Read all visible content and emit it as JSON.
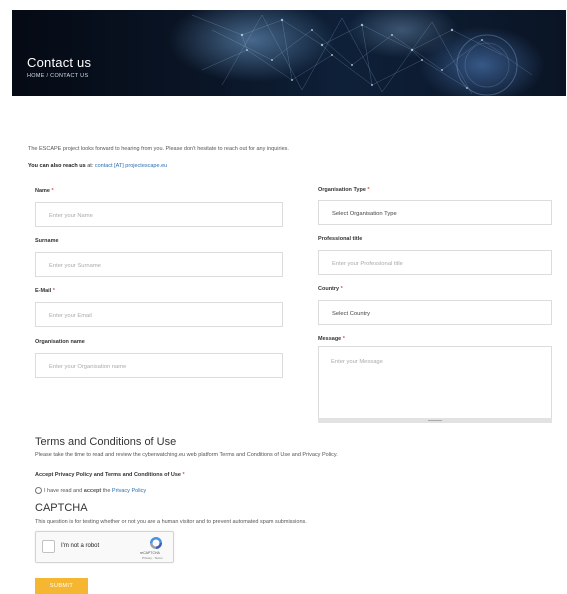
{
  "banner": {
    "title": "Contact us",
    "breadcrumb": "HOME / CONTACT US"
  },
  "intro": {
    "text": "The ESCAPE project looks forward to hearing from you. Please don't hesitate to reach out for any inquiries.",
    "reach_label": "You can also reach us",
    "reach_at": " at: ",
    "reach_email": "contact [AT] projectescape.eu"
  },
  "form": {
    "required_mark": "*",
    "name": {
      "label": "Name",
      "placeholder": "Enter your Name"
    },
    "surname": {
      "label": "Surname",
      "placeholder": "Enter your Surname"
    },
    "email": {
      "label": "E-Mail",
      "placeholder": "Enter your Email"
    },
    "organisation_name": {
      "label": "Organisation name",
      "placeholder": "Enter your Organisation name"
    },
    "organisation_type": {
      "label": "Organisation Type",
      "value": "Select Organisation Type"
    },
    "professional_title": {
      "label": "Professional title",
      "placeholder": "Enter your Professional title"
    },
    "country": {
      "label": "Country",
      "value": "Select Country"
    },
    "message": {
      "label": "Message",
      "placeholder": "Enter your Message"
    }
  },
  "terms": {
    "heading": "Terms and Conditions of Use",
    "text": "Please take the time to read and review the cyberwatching.eu web platform Terms and Conditions of Use and Privacy Policy.",
    "accept_label": "Accept Privacy Policy and Terms and Conditions of Use",
    "checkbox_prefix": "I have read and ",
    "checkbox_bold": "accept",
    "checkbox_the": " the ",
    "checkbox_link": "Privacy Policy"
  },
  "captcha": {
    "heading": "CAPTCHA",
    "text": "This question is for testing whether or not you are a human visitor and to prevent automated spam submissions.",
    "robot_label": "I'm not a robot",
    "brand": "reCAPTCHA",
    "privacy_terms": "Privacy - Terms"
  },
  "submit": {
    "label": "SUBMIT"
  },
  "colors": {
    "accent": "#f5b731",
    "link": "#2a6fb0",
    "required": "#d9534f",
    "banner_dark": "#0a1526"
  },
  "icons": {
    "recaptcha": "recaptcha-logo-icon"
  }
}
